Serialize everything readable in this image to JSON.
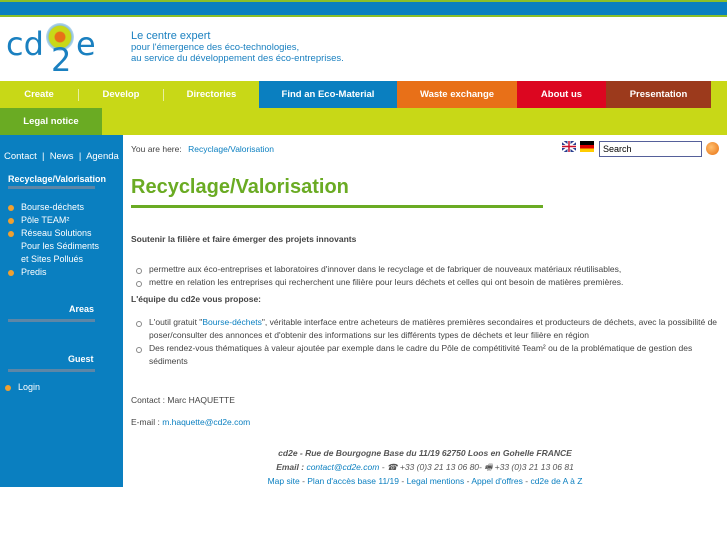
{
  "header": {
    "logo_text": "cd2e",
    "tagline_line1": "Le centre expert",
    "tagline_line2": "pour l'émergence des éco-technologies,",
    "tagline_line3": "au service du développement des éco-entreprises."
  },
  "nav": {
    "items": [
      {
        "label": "Create",
        "color": "#c8d817"
      },
      {
        "label": "Develop",
        "color": "#c8d817"
      },
      {
        "label": "Directories",
        "color": "#c8d817"
      },
      {
        "label": "Find an Eco-Material",
        "color": "#0a7fc0"
      },
      {
        "label": "Waste exchange",
        "color": "#e87018"
      },
      {
        "label": "About us",
        "color": "#dc0620"
      },
      {
        "label": "Presentation",
        "color": "#9c3a1c"
      }
    ],
    "legal": "Legal notice"
  },
  "sidebar": {
    "contact": "Contact",
    "news": "News",
    "agenda": "Agenda",
    "sep": "|",
    "section_title": "Recyclage/Valorisation",
    "links": [
      "Bourse-déchets",
      "Pôle TEAM²",
      "Réseau Solutions",
      "Pour les Sédiments",
      "et Sites Pollués",
      "Predis"
    ],
    "areas": "Areas",
    "guest": "Guest",
    "login": "Login"
  },
  "breadcrumb": {
    "prefix": "You are here:",
    "current": "Recyclage/Valorisation"
  },
  "search": {
    "value": "Search"
  },
  "main": {
    "title": "Recyclage/Valorisation",
    "intro": "Soutenir la filière et faire émerger des projets innovants",
    "list1": [
      "permettre aux éco-entreprises et laboratoires d'innover dans le recyclage et de fabriquer de nouveaux matériaux réutilisables,",
      "mettre en relation les entreprises qui recherchent une filière pour leurs déchets et celles qui ont besoin de matières premières."
    ],
    "team_heading": "L'équipe du cd2e vous propose:",
    "list2_item1_pre": "L'outil gratuit \"",
    "list2_item1_link": "Bourse-déchets",
    "list2_item1_post": "\", véritable interface entre acheteurs de matières premières secondaires et producteurs de déchets, avec la possibilité de poser/consulter des annonces et d'obtenir des informations sur les différents types de déchets et leur filière en région",
    "list2_item2": "Des rendez-vous thématiques à valeur ajoutée par exemple dans le cadre du Pôle de compétitivité Team² ou de la problématique de gestion des sédiments",
    "contact": "Contact : Marc HAQUETTE",
    "email_label": "E-mail :",
    "email": "m.haquette@cd2e.com"
  },
  "footer": {
    "address": "cd2e - Rue de Bourgogne Base du 11/19 62750 Loos en Gohelle FRANCE",
    "email_label": "Email :",
    "email": "contact@cd2e.com",
    "phone": "+33 (0)3 21 13 06 80-",
    "fax": "+33 (0)3 21 13 06 81",
    "links": [
      "Map site",
      "Plan d'accès base 11/19",
      "Legal mentions",
      "Appel d'offres",
      "cd2e de A à Z"
    ]
  }
}
